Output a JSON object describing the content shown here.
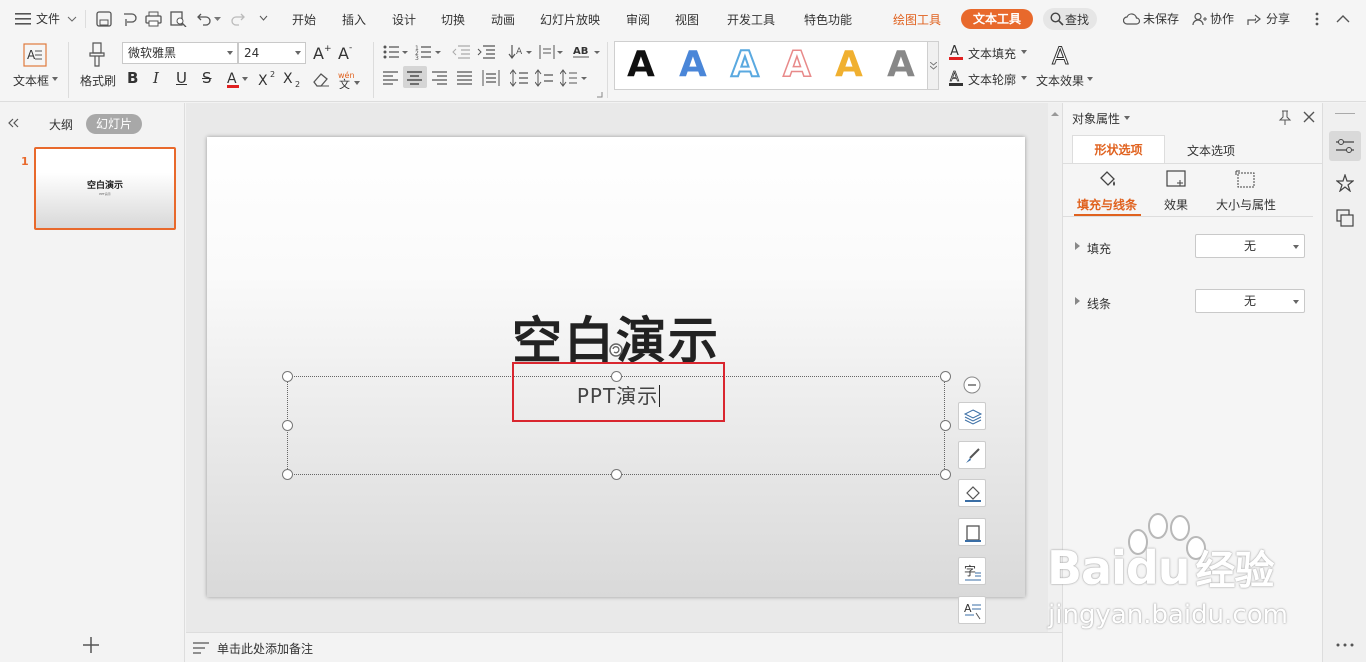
{
  "menubar": {
    "file_label": "文件",
    "tabs": [
      "开始",
      "插入",
      "设计",
      "切换",
      "动画",
      "幻灯片放映",
      "审阅",
      "视图",
      "开发工具",
      "特色功能"
    ],
    "draw_tools": "绘图工具",
    "text_tools": "文本工具",
    "search": "查找",
    "unsaved": "未保存",
    "collab": "协作",
    "share": "分享"
  },
  "ribbon": {
    "textbox_label": "文本框",
    "format_painter": "格式刷",
    "font_name": "微软雅黑",
    "font_size": "24",
    "text_fill": "文本填充",
    "text_outline": "文本轮廓",
    "text_effect": "文本效果",
    "gallery_letter": "A",
    "style_colors": [
      "#111111",
      "#4a86d8",
      "#5aa9e0",
      "#e88a8a",
      "#f0b030",
      "#888888"
    ]
  },
  "left": {
    "outline_tab": "大纲",
    "slides_tab": "幻灯片",
    "slide_number": "1",
    "thumb_title": "空白演示",
    "thumb_sub": "PPT演示"
  },
  "slide": {
    "title": "空白演示",
    "subtitle": "PPT演示"
  },
  "notes_placeholder": "单击此处添加备注",
  "props": {
    "header": "对象属性",
    "tab_shape": "形状选项",
    "tab_text": "文本选项",
    "sub_fill_line": "填充与线条",
    "sub_effect": "效果",
    "sub_size": "大小与属性",
    "fill_label": "填充",
    "fill_value": "无",
    "line_label": "线条",
    "line_value": "无"
  },
  "watermark": {
    "brand": "Baidu",
    "brand_cn": "经验",
    "url": "jingyan.baidu.com"
  },
  "colors": {
    "accent": "#e8692c",
    "selection_red": "#d9262f"
  }
}
